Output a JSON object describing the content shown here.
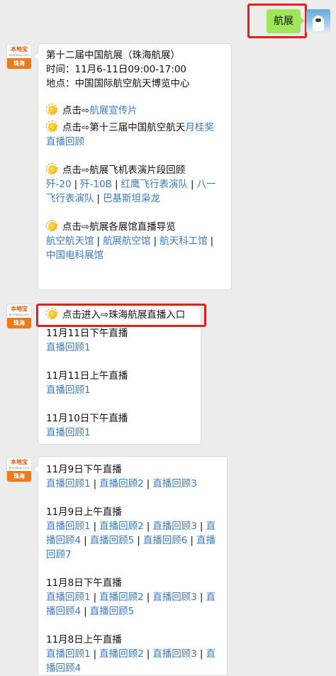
{
  "sent": {
    "text": "航展"
  },
  "avatar": {
    "logo_text": "本地宝",
    "logo_sub": "bendibao.com",
    "badge": "珠海"
  },
  "icons": {
    "sun": "sun-emoji-icon",
    "arrow": "⇨"
  },
  "msg1": {
    "title": "第十二届中国航展（珠海航展）",
    "time": "时间：11月6-11日09:00-17:00",
    "place": "地点：中国国际航空航天博览中心",
    "promo_prefix": "点击⇨",
    "promo_link": "航展宣传片",
    "award_prefix": "点击⇨第十三届中国航空航天",
    "award_link1": "月桂奖",
    "award_link2": "直播回顾",
    "flight_prefix": "点击⇨航展飞机表演片段回顾",
    "flight_links": [
      "歼-20",
      "歼-10B",
      "红鹰飞行表演队",
      "八一飞行表演队",
      "巴基斯坦枭龙"
    ],
    "halls_prefix": "点击⇨航展各展馆直播导览",
    "halls_links": [
      "航空航天馆",
      "航展航空馆",
      "航天科工馆",
      "中国电科展馆"
    ]
  },
  "msg2": {
    "entry": "点击进入⇨珠海航展直播入口",
    "items": [
      {
        "label": "11月11日下午直播",
        "link": "直播回顾1"
      },
      {
        "label": "11月11日上午直播",
        "link": "直播回顾1"
      },
      {
        "label": "11月10日下午直播",
        "link": "直播回顾1"
      }
    ]
  },
  "msg3": {
    "groups": [
      {
        "label": "11月9日下午直播",
        "links": [
          "直播回顾1",
          "直播回顾2",
          "直播回顾3"
        ]
      },
      {
        "label": "11月9日上午直播",
        "links": [
          "直播回顾1",
          "直播回顾2",
          "直播回顾3",
          "直播回顾4",
          "直播回顾5",
          "直播回顾6",
          "直播回顾7"
        ]
      },
      {
        "label": "11月8日下午直播",
        "links": [
          "直播回顾1",
          "直播回顾2",
          "直播回顾3",
          "直播回顾4",
          "直播回顾5"
        ]
      },
      {
        "label": "11月8日上午直播",
        "links": [
          "直播回顾1",
          "直播回顾2",
          "直播回顾3",
          "直播回顾4"
        ]
      }
    ]
  }
}
